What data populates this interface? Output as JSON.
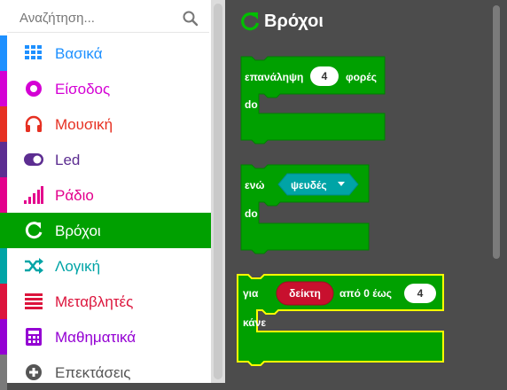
{
  "search": {
    "placeholder": "Αναζήτηση..."
  },
  "categories": [
    {
      "label": "Βασικά",
      "color": "#1e90ff",
      "icon": "grid-icon"
    },
    {
      "label": "Είσοδος",
      "color": "#d400d4",
      "icon": "input-icon"
    },
    {
      "label": "Μουσική",
      "color": "#e63022",
      "icon": "headphones-icon"
    },
    {
      "label": "Led",
      "color": "#5c2d91",
      "icon": "toggle-icon"
    },
    {
      "label": "Ράδιο",
      "color": "#e3008c",
      "icon": "signal-bars-icon"
    },
    {
      "label": "Βρόχοι",
      "color": "#00a000",
      "icon": "loop-icon",
      "selected": true
    },
    {
      "label": "Λογική",
      "color": "#00a4a6",
      "icon": "shuffle-icon"
    },
    {
      "label": "Μεταβλητές",
      "color": "#dc143c",
      "icon": "list-icon"
    },
    {
      "label": "Μαθηματικά",
      "color": "#9400d3",
      "icon": "calculator-icon"
    },
    {
      "label": "Επεκτάσεις",
      "color": "#7a7a7a",
      "icon": "plus-circle-icon"
    }
  ],
  "flyout": {
    "title": "Βρόχοι",
    "repeat_block": {
      "prefix": "επανάληψη",
      "count": "4",
      "suffix": "φορές",
      "do": "do"
    },
    "while_block": {
      "prefix": "ενώ",
      "condition": "ψευδές",
      "do": "do"
    },
    "for_block": {
      "prefix": "για",
      "variable": "δείκτη",
      "range_text": "από 0 έως",
      "end": "4",
      "do": "κάνε"
    }
  },
  "colors": {
    "loops_green": "#00a000",
    "loops_dark": "#008000",
    "logic_teal": "#00a4a6",
    "variable_red": "#dc143c",
    "highlight": "#ffff00"
  }
}
